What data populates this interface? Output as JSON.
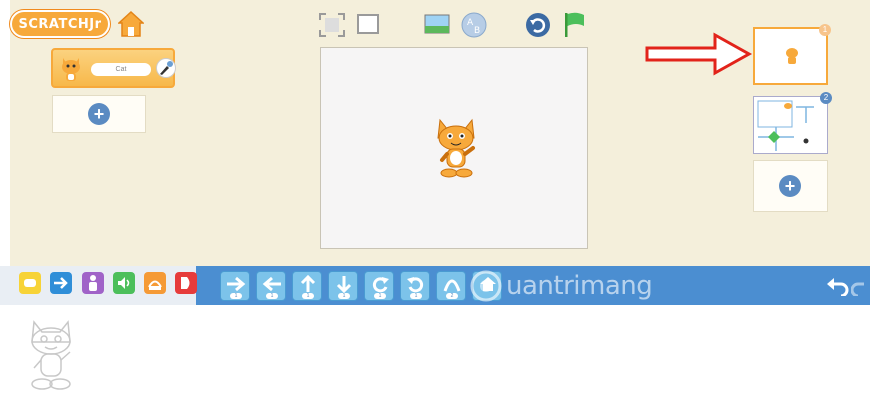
{
  "app": {
    "logo_text": "SCRATCHJr"
  },
  "sprites": [
    {
      "name": "Cat"
    }
  ],
  "pages": [
    {
      "number": "1"
    },
    {
      "number": "2"
    }
  ],
  "watermark": "uantrimang",
  "colors": {
    "workspace_bg": "#f4efdb",
    "palette_blue": "#4b8ed1",
    "block_blue": "#7cc3ea",
    "accent_orange": "#f7a93b",
    "annotation_red": "#e2231a"
  },
  "categories": [
    {
      "icon": "trigger-icon",
      "color": "#f7d337"
    },
    {
      "icon": "motion-icon",
      "color": "#2f8ed8"
    },
    {
      "icon": "looks-icon",
      "color": "#a063c8"
    },
    {
      "icon": "sound-icon",
      "color": "#4cbf5b"
    },
    {
      "icon": "control-icon",
      "color": "#f59a36"
    },
    {
      "icon": "end-icon",
      "color": "#e63b3b"
    }
  ],
  "blocks": [
    {
      "icon": "move-right-icon",
      "badge": "1"
    },
    {
      "icon": "move-left-icon",
      "badge": "1"
    },
    {
      "icon": "move-up-icon",
      "badge": "1"
    },
    {
      "icon": "move-down-icon",
      "badge": "1"
    },
    {
      "icon": "turn-right-icon",
      "badge": "1"
    },
    {
      "icon": "turn-left-icon",
      "badge": "1"
    },
    {
      "icon": "hop-icon",
      "badge": "2"
    },
    {
      "icon": "go-home-icon",
      "badge": ""
    }
  ]
}
